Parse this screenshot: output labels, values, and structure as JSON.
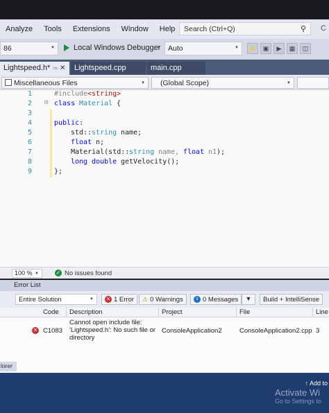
{
  "menubar": {
    "items": [
      "Analyze",
      "Tools",
      "Extensions",
      "Window",
      "Help"
    ],
    "search_placeholder": "Search (Ctrl+Q)",
    "edge_char": "C"
  },
  "toolbar": {
    "config_value": "86",
    "debugger_label": "Local Windows Debugger",
    "auto_value": "Auto"
  },
  "tabs": [
    {
      "label": "Lightspeed.h*",
      "active": true
    },
    {
      "label": "Lightspeed.cpp",
      "active": false
    },
    {
      "label": "main.cpp",
      "active": false
    }
  ],
  "navbar": {
    "files_label": "Miscellaneous Files",
    "scope_label": "(Global Scope)"
  },
  "editor": {
    "line_numbers": [
      "1",
      "2",
      "3",
      "4",
      "5",
      "6",
      "7",
      "8",
      "9"
    ],
    "lines": {
      "l1_directive": "#include",
      "l1_string": "<string>",
      "l2_kw": "class",
      "l2_name": "Material",
      "l2_brace": "{",
      "l4_kw": "public:",
      "l5_ns": "std::",
      "l5_type": "string",
      "l5_rest": " name;",
      "l6_kw": "float",
      "l6_rest": " n;",
      "l7_fn": "Material(std::",
      "l7_type": "string",
      "l7_p1": " name, ",
      "l7_kw": "float",
      "l7_p2": " n1",
      "l7_end": ");",
      "l8_kw1": "long",
      "l8_kw2": "double",
      "l8_rest": "getVelocity();",
      "l9_end": "};"
    }
  },
  "statusstrip": {
    "zoom": "100 %",
    "issues": "No issues found"
  },
  "error_list": {
    "title": "Error List",
    "scope": "Entire Solution",
    "errors_btn": "1 Error",
    "warnings_btn": "0 Warnings",
    "messages_btn": "0 Messages",
    "build_filter": "Build + IntelliSense",
    "columns": {
      "code": "Code",
      "description": "Description",
      "project": "Project",
      "file": "File",
      "line": "Line"
    },
    "rows": [
      {
        "code": "C1083",
        "description": "Cannot open include file: 'Lightspeed.h': No such file or directory",
        "project": "ConsoleApplication2",
        "file": "ConsoleApplication2.cpp",
        "line": "3"
      }
    ]
  },
  "bottom": {
    "left_label": "lorer",
    "add_to": "Add to",
    "activate": "Activate Wi",
    "activate_sub": "Go to Settings to"
  }
}
